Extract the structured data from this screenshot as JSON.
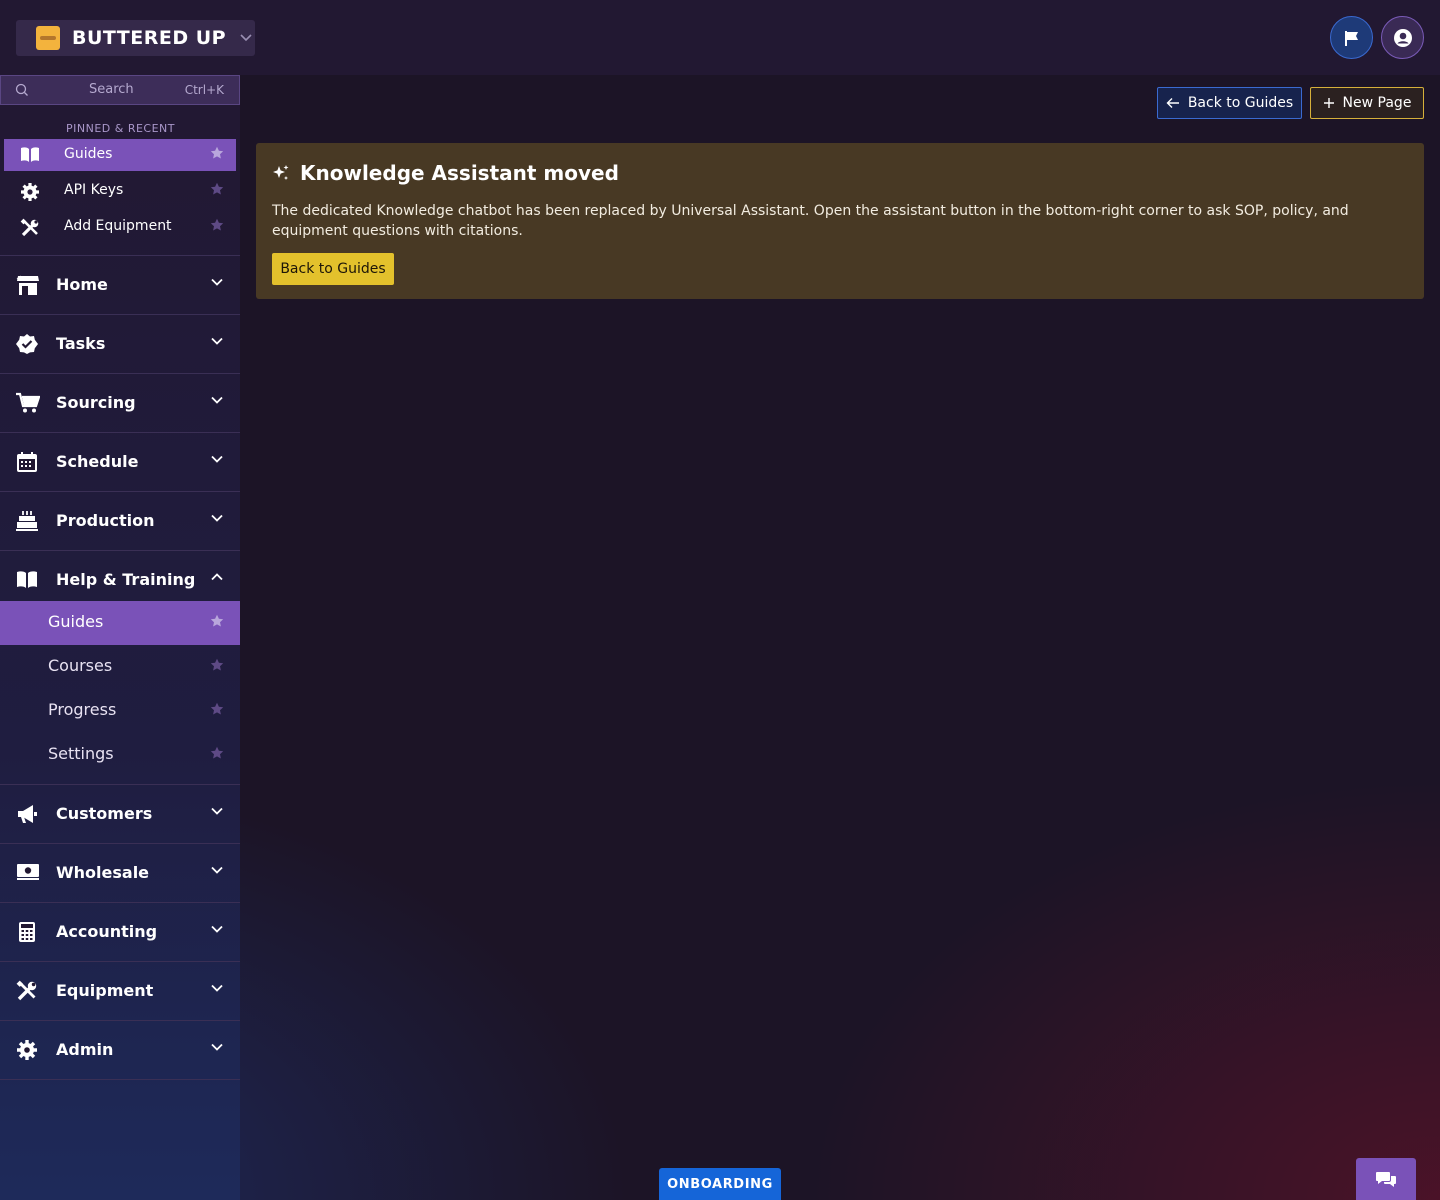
{
  "brand": {
    "name": "BUTTERED UP",
    "caret": "⌄"
  },
  "search": {
    "placeholder": "Search",
    "shortcut": "Ctrl+K"
  },
  "pinned": {
    "heading": "PINNED & RECENT",
    "items": [
      {
        "label": "Guides",
        "icon": "book-icon",
        "active": true
      },
      {
        "label": "API Keys",
        "icon": "gear-icon",
        "active": false
      },
      {
        "label": "Add Equipment",
        "icon": "tools-icon",
        "active": false
      }
    ]
  },
  "nav": {
    "sections": [
      {
        "label": "Home",
        "icon": "store-icon",
        "expanded": false
      },
      {
        "label": "Tasks",
        "icon": "check-badge-icon",
        "expanded": false
      },
      {
        "label": "Sourcing",
        "icon": "cart-icon",
        "expanded": false
      },
      {
        "label": "Schedule",
        "icon": "calendar-icon",
        "expanded": false
      },
      {
        "label": "Production",
        "icon": "cake-icon",
        "expanded": false
      },
      {
        "label": "Help & Training",
        "icon": "book-icon",
        "expanded": true
      },
      {
        "label": "Customers",
        "icon": "megaphone-icon",
        "expanded": false
      },
      {
        "label": "Wholesale",
        "icon": "money-icon",
        "expanded": false
      },
      {
        "label": "Accounting",
        "icon": "calculator-icon",
        "expanded": false
      },
      {
        "label": "Equipment",
        "icon": "tools-icon",
        "expanded": false
      },
      {
        "label": "Admin",
        "icon": "gear-icon",
        "expanded": false
      }
    ],
    "help_items": [
      {
        "label": "Guides",
        "active": true
      },
      {
        "label": "Courses",
        "active": false
      },
      {
        "label": "Progress",
        "active": false
      },
      {
        "label": "Settings",
        "active": false
      }
    ]
  },
  "toolbar": {
    "back_label": "Back to Guides",
    "new_label": "New Page"
  },
  "notice": {
    "title": "Knowledge Assistant moved",
    "body": "The dedicated Knowledge chatbot has been replaced by Universal Assistant. Open the assistant button in the bottom-right corner to ask SOP, policy, and equipment questions with citations.",
    "button": "Back to Guides"
  },
  "footer": {
    "onboarding": "ONBOARDING"
  },
  "colors": {
    "accent_purple": "#7a52b8",
    "notice_bg": "#483924",
    "notice_button": "#e3c12c",
    "onboarding_blue": "#1565d8"
  }
}
